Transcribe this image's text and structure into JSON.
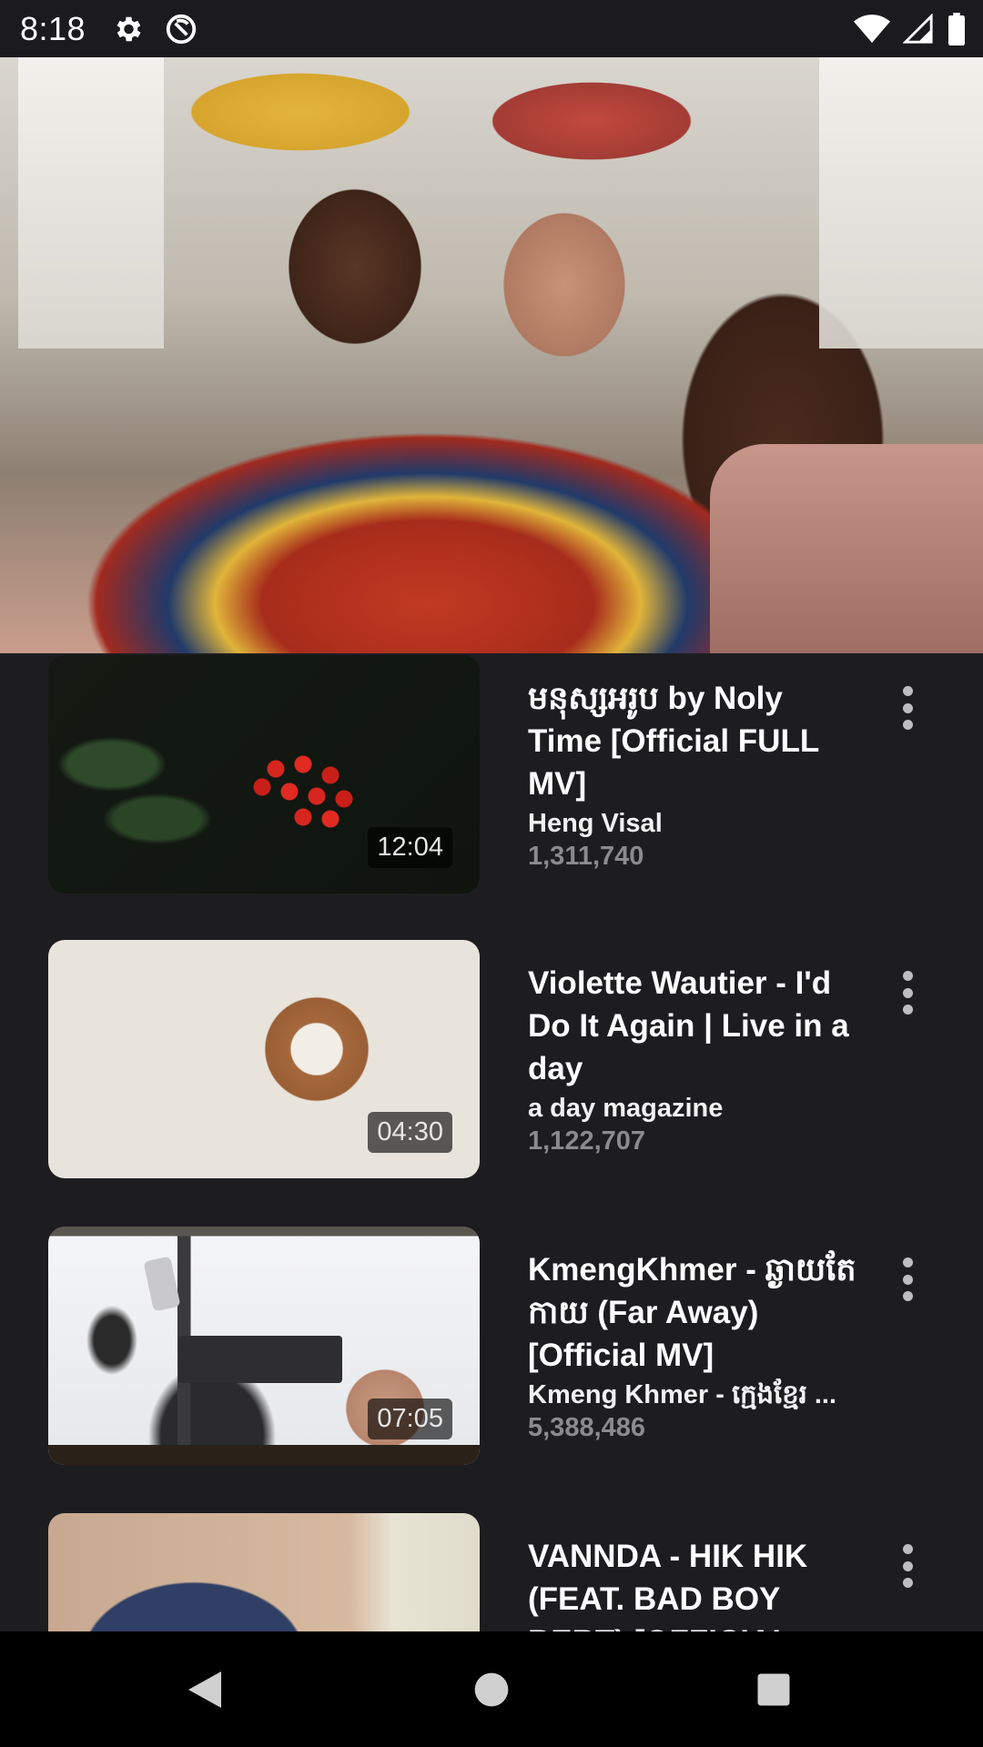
{
  "status_bar": {
    "time": "8:18",
    "left_icons": [
      "gear-icon",
      "no-symbol-icon"
    ],
    "right_icons": [
      "wifi-icon",
      "signal-icon",
      "battery-icon"
    ]
  },
  "hero": {
    "image": "mother-and-daughter-hug-photo"
  },
  "videos": [
    {
      "title": "មនុស្សអរូប by Noly Time [Official FULL MV]",
      "channel": "Heng Visal",
      "views": "1,311,740",
      "duration": "12:04",
      "thumbnail": "red-berries-branch"
    },
    {
      "title": "Violette Wautier - I'd Do It Again | Live in a day",
      "channel": "a day magazine",
      "views": "1,122,707",
      "duration": "04:30",
      "thumbnail": "latte-and-pastry"
    },
    {
      "title": "KmengKhmer - ឆ្ងាយតែកាយ (Far Away) [Official MV]",
      "channel": "Kmeng Khmer - ក្មេងខ្មែរ ...",
      "views": "5,388,486",
      "duration": "07:05",
      "thumbnail": "desk-with-keyboard"
    },
    {
      "title": "VANNDA - HIK HIK (FEAT. BAD BOY BERT) [OFFICIAL",
      "channel": "",
      "views": "",
      "duration": "",
      "thumbnail": "person-with-cap"
    }
  ],
  "nav_bar": {
    "buttons": [
      "back-icon",
      "home-icon",
      "recents-icon"
    ]
  },
  "colors": {
    "background": "#1d1d20",
    "status_bar": "#1b1b1e",
    "views_text": "#8a8a8f",
    "nav_bar": "#000000"
  }
}
